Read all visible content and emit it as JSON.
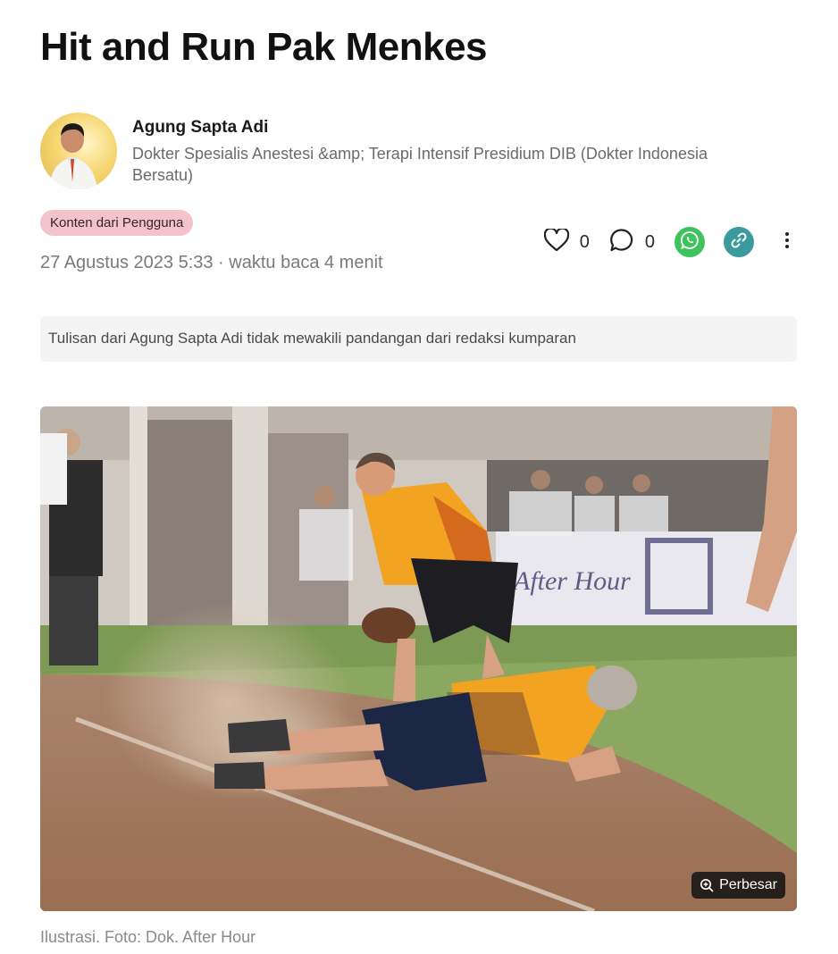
{
  "article": {
    "title": "Hit and Run Pak Menkes",
    "label_badge": "Konten dari Pengguna",
    "dateline": "27 Agustus 2023 5:33 · waktu baca 4 menit",
    "disclaimer": "Tulisan dari Agung Sapta Adi tidak mewakili pandangan dari redaksi kumparan"
  },
  "author": {
    "name": "Agung Sapta Adi",
    "bio": "Dokter Spesialis Anestesi &amp; Terapi Intensif Presidium DIB (Dokter Indonesia Bersatu)"
  },
  "actions": {
    "like_count": "0",
    "comment_count": "0",
    "icons": [
      "heart-icon",
      "comment-icon",
      "whatsapp-icon",
      "link-icon",
      "more-icon"
    ],
    "whatsapp_color": "#3ec35e",
    "link_color": "#3b9a9e"
  },
  "photo": {
    "zoom_label": "Perbesar",
    "caption": "Ilustrasi. Foto: Dok. After Hour",
    "banner_text": "After Hour"
  },
  "colors": {
    "badge_bg": "#f3c3cc",
    "disclaimer_bg": "#f4f4f4"
  }
}
